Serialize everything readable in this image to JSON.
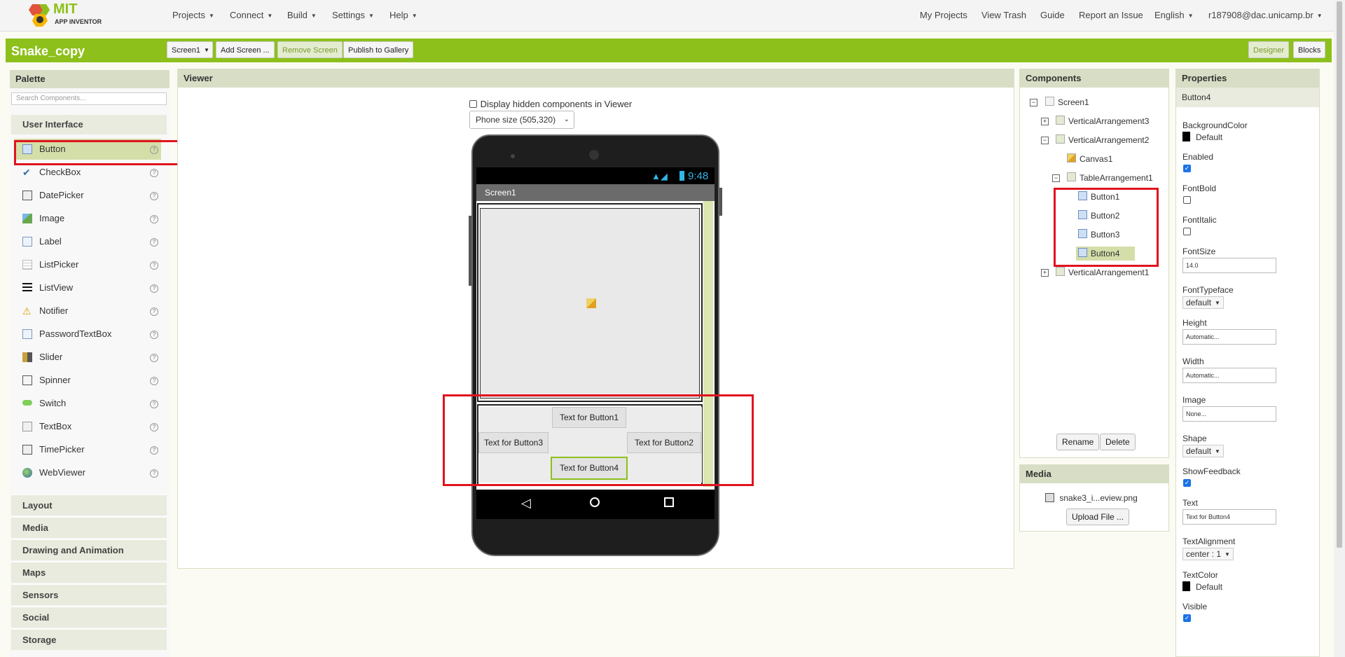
{
  "colors": {
    "accent": "#8dc01b",
    "highlight": "#e0141e",
    "selected": "#d4dea8"
  },
  "app": {
    "logo_top": "MIT",
    "logo_bottom": "APP INVENTOR"
  },
  "nav": {
    "projects": "Projects",
    "connect": "Connect",
    "build": "Build",
    "settings": "Settings",
    "help": "Help",
    "my_projects": "My Projects",
    "view_trash": "View Trash",
    "guide": "Guide",
    "report": "Report an Issue",
    "language": "English",
    "user": "r187908@dac.unicamp.br"
  },
  "project": {
    "name": "Snake_copy",
    "screen_select": "Screen1",
    "add_screen": "Add Screen ...",
    "remove_screen": "Remove Screen",
    "publish": "Publish to Gallery",
    "designer": "Designer",
    "blocks": "Blocks"
  },
  "palette": {
    "title": "Palette",
    "search_placeholder": "Search Components...",
    "current_category": "User Interface",
    "items": [
      {
        "label": "Button",
        "icon": "button-icon"
      },
      {
        "label": "CheckBox",
        "icon": "checkbox-icon"
      },
      {
        "label": "DatePicker",
        "icon": "calendar-icon"
      },
      {
        "label": "Image",
        "icon": "image-icon"
      },
      {
        "label": "Label",
        "icon": "label-icon"
      },
      {
        "label": "ListPicker",
        "icon": "list-icon"
      },
      {
        "label": "ListView",
        "icon": "listview-icon"
      },
      {
        "label": "Notifier",
        "icon": "warning-icon"
      },
      {
        "label": "PasswordTextBox",
        "icon": "password-icon"
      },
      {
        "label": "Slider",
        "icon": "slider-icon"
      },
      {
        "label": "Spinner",
        "icon": "spinner-icon"
      },
      {
        "label": "Switch",
        "icon": "switch-icon"
      },
      {
        "label": "TextBox",
        "icon": "textbox-icon"
      },
      {
        "label": "TimePicker",
        "icon": "clock-icon"
      },
      {
        "label": "WebViewer",
        "icon": "globe-icon"
      }
    ],
    "help_glyph": "?",
    "categories": [
      "Layout",
      "Media",
      "Drawing and Animation",
      "Maps",
      "Sensors",
      "Social",
      "Storage"
    ]
  },
  "viewer": {
    "title": "Viewer",
    "hidden_label": "Display hidden components in Viewer",
    "size_option": "Phone size (505,320)",
    "phone": {
      "time": "9:48",
      "screen_title": "Screen1",
      "button1": "Text for Button1",
      "button2": "Text for Button2",
      "button3": "Text for Button3",
      "button4": "Text for Button4"
    }
  },
  "components": {
    "title": "Components",
    "tree": [
      {
        "label": "Screen1",
        "toggle": "−"
      },
      {
        "label": "VerticalArrangement3",
        "toggle": "+"
      },
      {
        "label": "VerticalArrangement2",
        "toggle": "−"
      },
      {
        "label": "Canvas1",
        "toggle": ""
      },
      {
        "label": "TableArrangement1",
        "toggle": "−"
      },
      {
        "label": "Button1",
        "toggle": ""
      },
      {
        "label": "Button2",
        "toggle": ""
      },
      {
        "label": "Button3",
        "toggle": ""
      },
      {
        "label": "Button4",
        "toggle": ""
      },
      {
        "label": "VerticalArrangement1",
        "toggle": "+"
      }
    ],
    "rename": "Rename",
    "delete": "Delete"
  },
  "media": {
    "title": "Media",
    "file": "snake3_i...eview.png",
    "upload": "Upload File ..."
  },
  "properties": {
    "title": "Properties",
    "component": "Button4",
    "background_color_label": "BackgroundColor",
    "background_color_value": "Default",
    "enabled_label": "Enabled",
    "enabled": true,
    "fontbold_label": "FontBold",
    "fontbold": false,
    "fontitalic_label": "FontItalic",
    "fontitalic": false,
    "fontsize_label": "FontSize",
    "fontsize_value": "14.0",
    "fonttypeface_label": "FontTypeface",
    "fonttypeface_value": "default",
    "height_label": "Height",
    "height_value": "Automatic...",
    "width_label": "Width",
    "width_value": "Automatic...",
    "image_label": "Image",
    "image_value": "None...",
    "shape_label": "Shape",
    "shape_value": "default",
    "showfeedback_label": "ShowFeedback",
    "showfeedback": true,
    "text_label": "Text",
    "text_value": "Text for Button4",
    "textalignment_label": "TextAlignment",
    "textalignment_value": "center : 1",
    "textcolor_label": "TextColor",
    "textcolor_value": "Default",
    "visible_label": "Visible",
    "visible": true
  }
}
